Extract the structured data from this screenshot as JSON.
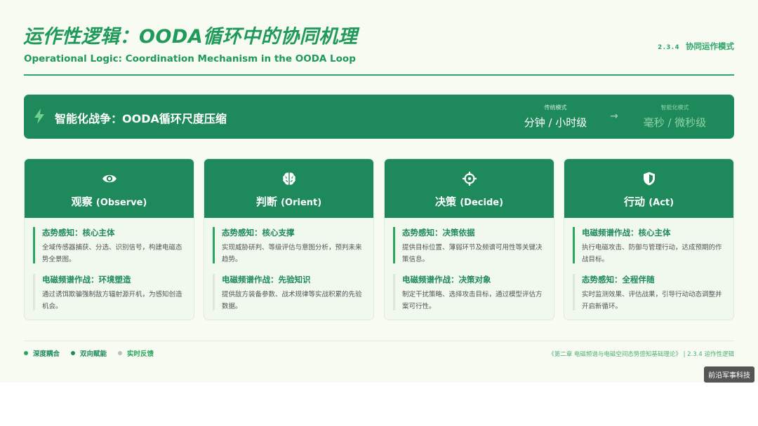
{
  "header": {
    "title_cn": "运作性逻辑：OODA循环中的协同机理",
    "title_en": "Operational Logic: Coordination Mechanism in the OODA Loop",
    "section_num": "2.3.4",
    "section_label": "协同运作模式"
  },
  "banner": {
    "icon": "bolt-icon",
    "title": "智能化战争：OODA循环尺度压缩",
    "traditional": {
      "label": "传统模式",
      "value": "分钟 / 小时级"
    },
    "arrow": "→",
    "intelligent": {
      "label": "智能化模式",
      "value": "毫秒 / 微秒级"
    }
  },
  "cards": [
    {
      "icon": "eye-icon",
      "title_cn": "观察",
      "title_en": "(Observe)",
      "items": [
        {
          "title": "态势感知：核心主体",
          "text": "全域传感器捕获、分选、识别信号，构建电磁态势全景图。"
        },
        {
          "title": "电磁频谱作战：环境塑造",
          "text": "通过诱饵欺骗强制敌方辐射源开机，为感知创造机会。"
        }
      ]
    },
    {
      "icon": "brain-icon",
      "title_cn": "判断",
      "title_en": "(Orient)",
      "items": [
        {
          "title": "态势感知：核心支撑",
          "text": "实现威胁研判、等级评估与意图分析，预判未来趋势。"
        },
        {
          "title": "电磁频谱作战：先验知识",
          "text": "提供敌方装备参数、战术规律等实战积累的先验数据。"
        }
      ]
    },
    {
      "icon": "crosshair-icon",
      "title_cn": "决策",
      "title_en": "(Decide)",
      "items": [
        {
          "title": "态势感知：决策依据",
          "text": "提供目标位置、薄弱环节及频谱可用性等关键决策信息。"
        },
        {
          "title": "电磁频谱作战：决策对象",
          "text": "制定干扰策略、选择攻击目标，通过模型评估方案可行性。"
        }
      ]
    },
    {
      "icon": "shield-icon",
      "title_cn": "行动",
      "title_en": "(Act)",
      "items": [
        {
          "title": "电磁频谱作战：核心主体",
          "text": "执行电磁攻击、防御与管理行动，达成预期的作战目标。"
        },
        {
          "title": "态势感知：全程伴随",
          "text": "实时监测效果、评估战果，引导行动动态调整并开启新循环。"
        }
      ]
    }
  ],
  "footer": {
    "legend": [
      {
        "label": "深度耦合",
        "color": "#2aa65f"
      },
      {
        "label": "双向赋能",
        "color": "#1e8a5c"
      },
      {
        "label": "实时反馈",
        "color": "#b8bec3"
      }
    ],
    "note": "《第二章 电磁频谱与电磁空间态势感知基础理论》 | 2.3.4 运作性逻辑"
  },
  "watermark": "前沿军事科技",
  "colors": {
    "primary": "#1e8a5c",
    "accent": "#2aa65f",
    "background": "#f7fbf2"
  }
}
